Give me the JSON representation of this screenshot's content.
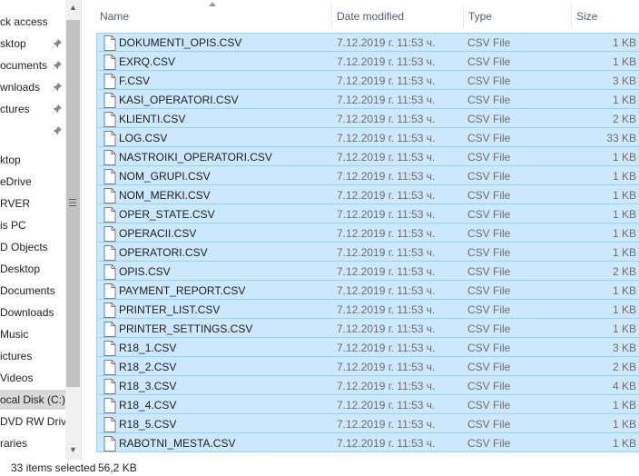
{
  "nav": {
    "items": [
      {
        "label": "ck access",
        "pinned": false
      },
      {
        "label": "sktop",
        "pinned": true
      },
      {
        "label": "ocuments",
        "pinned": true
      },
      {
        "label": "wnloads",
        "pinned": true
      },
      {
        "label": "ctures",
        "pinned": true
      },
      {
        "label": "",
        "pinned": true
      },
      {
        "label": "ktop",
        "pinned": false
      },
      {
        "label": "eDrive",
        "pinned": false
      },
      {
        "label": "RVER",
        "pinned": false
      },
      {
        "label": "is PC",
        "pinned": false
      },
      {
        "label": "D Objects",
        "pinned": false
      },
      {
        "label": "Desktop",
        "pinned": false
      },
      {
        "label": "Documents",
        "pinned": false
      },
      {
        "label": "Downloads",
        "pinned": false
      },
      {
        "label": "Music",
        "pinned": false
      },
      {
        "label": "ictures",
        "pinned": false
      },
      {
        "label": "Videos",
        "pinned": false
      },
      {
        "label": "ocal Disk (C:)",
        "pinned": false,
        "selected": true
      },
      {
        "label": "DVD RW Drive",
        "pinned": false
      },
      {
        "label": "raries",
        "pinned": false
      }
    ]
  },
  "columns": {
    "name": "Name",
    "date": "Date modified",
    "type": "Type",
    "size": "Size"
  },
  "files": [
    {
      "name": "DOKUMENTI_OPIS.CSV",
      "date": "7.12.2019 г. 11:53 ч.",
      "type": "CSV File",
      "size": "1 KB"
    },
    {
      "name": "EXRQ.CSV",
      "date": "7.12.2019 г. 11:53 ч.",
      "type": "CSV File",
      "size": "1 KB"
    },
    {
      "name": "F.CSV",
      "date": "7.12.2019 г. 11:53 ч.",
      "type": "CSV File",
      "size": "3 KB"
    },
    {
      "name": "KASI_OPERATORI.CSV",
      "date": "7.12.2019 г. 11:53 ч.",
      "type": "CSV File",
      "size": "1 KB"
    },
    {
      "name": "KLIENTI.CSV",
      "date": "7.12.2019 г. 11:53 ч.",
      "type": "CSV File",
      "size": "2 KB"
    },
    {
      "name": "LOG.CSV",
      "date": "7.12.2019 г. 11:53 ч.",
      "type": "CSV File",
      "size": "33 KB"
    },
    {
      "name": "NASTROIKI_OPERATORI.CSV",
      "date": "7.12.2019 г. 11:53 ч.",
      "type": "CSV File",
      "size": "1 KB"
    },
    {
      "name": "NOM_GRUPI.CSV",
      "date": "7.12.2019 г. 11:53 ч.",
      "type": "CSV File",
      "size": "1 KB"
    },
    {
      "name": "NOM_MERKI.CSV",
      "date": "7.12.2019 г. 11:53 ч.",
      "type": "CSV File",
      "size": "1 KB"
    },
    {
      "name": "OPER_STATE.CSV",
      "date": "7.12.2019 г. 11:53 ч.",
      "type": "CSV File",
      "size": "1 KB"
    },
    {
      "name": "OPERACII.CSV",
      "date": "7.12.2019 г. 11:53 ч.",
      "type": "CSV File",
      "size": "1 KB"
    },
    {
      "name": "OPERATORI.CSV",
      "date": "7.12.2019 г. 11:53 ч.",
      "type": "CSV File",
      "size": "1 KB"
    },
    {
      "name": "OPIS.CSV",
      "date": "7.12.2019 г. 11:53 ч.",
      "type": "CSV File",
      "size": "2 KB"
    },
    {
      "name": "PAYMENT_REPORT.CSV",
      "date": "7.12.2019 г. 11:53 ч.",
      "type": "CSV File",
      "size": "1 KB"
    },
    {
      "name": "PRINTER_LIST.CSV",
      "date": "7.12.2019 г. 11:53 ч.",
      "type": "CSV File",
      "size": "1 KB"
    },
    {
      "name": "PRINTER_SETTINGS.CSV",
      "date": "7.12.2019 г. 11:53 ч.",
      "type": "CSV File",
      "size": "1 KB"
    },
    {
      "name": "R18_1.CSV",
      "date": "7.12.2019 г. 11:53 ч.",
      "type": "CSV File",
      "size": "3 KB"
    },
    {
      "name": "R18_2.CSV",
      "date": "7.12.2019 г. 11:53 ч.",
      "type": "CSV File",
      "size": "2 KB"
    },
    {
      "name": "R18_3.CSV",
      "date": "7.12.2019 г. 11:53 ч.",
      "type": "CSV File",
      "size": "4 KB"
    },
    {
      "name": "R18_4.CSV",
      "date": "7.12.2019 г. 11:53 ч.",
      "type": "CSV File",
      "size": "1 KB"
    },
    {
      "name": "R18_5.CSV",
      "date": "7.12.2019 г. 11:53 ч.",
      "type": "CSV File",
      "size": "1 KB"
    },
    {
      "name": "RABOTNI_MESTA.CSV",
      "date": "7.12.2019 г. 11:53 ч.",
      "type": "CSV File",
      "size": "1 KB"
    }
  ],
  "status": {
    "count": "33 items selected",
    "size": "56,2 KB"
  },
  "colors": {
    "selection_bg": "#cce8ff",
    "selection_border": "#99d1ff",
    "header_text": "#4c607a",
    "secondary_text": "#6d6d6d"
  }
}
